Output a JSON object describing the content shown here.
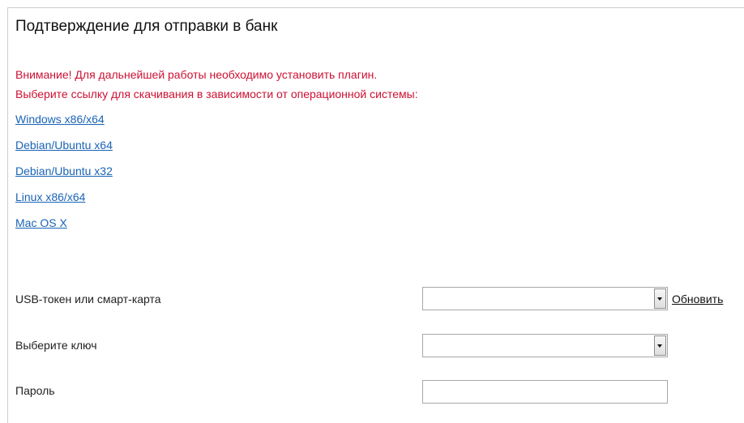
{
  "header": {
    "title": "Подтверждение для отправки в банк"
  },
  "warning": {
    "line1": "Внимание! Для дальнейшей работы необходимо установить плагин.",
    "line2": "Выберите ссылку для скачивания в зависимости от операционной системы:"
  },
  "downloads": {
    "items": [
      {
        "label": "Windows x86/x64"
      },
      {
        "label": "Debian/Ubuntu x64"
      },
      {
        "label": "Debian/Ubuntu x32"
      },
      {
        "label": "Linux x86/x64"
      },
      {
        "label": "Mac OS X"
      }
    ]
  },
  "form": {
    "usb_token": {
      "label": "USB-токен или смарт-карта",
      "value": "",
      "refresh_label": "Обновить"
    },
    "key": {
      "label": "Выберите ключ",
      "value": ""
    },
    "password": {
      "label": "Пароль",
      "value": ""
    }
  },
  "colors": {
    "warning": "#cc1133",
    "link": "#1a63b5",
    "border": "#a8a8a8"
  }
}
